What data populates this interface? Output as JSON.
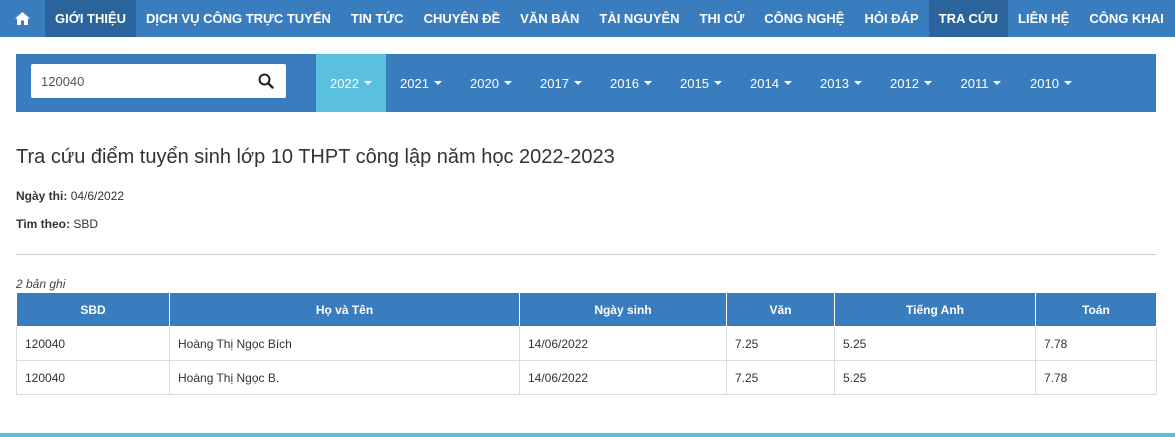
{
  "nav": {
    "home_icon": "home-icon",
    "items": [
      "GIỚI THIỆU",
      "DỊCH VỤ CÔNG TRỰC TUYẾN",
      "TIN TỨC",
      "CHUYÊN ĐỀ",
      "VĂN BẢN",
      "TÀI NGUYÊN",
      "THI CỬ",
      "CÔNG NGHỆ",
      "HỎI ĐÁP",
      "TRA CỨU",
      "LIÊN HỆ",
      "CÔNG KHAI"
    ]
  },
  "search": {
    "value": "120040",
    "icon": "search-icon"
  },
  "years": [
    "2022",
    "2021",
    "2020",
    "2017",
    "2016",
    "2015",
    "2014",
    "2013",
    "2012",
    "2011",
    "2010"
  ],
  "page": {
    "title": "Tra cứu điểm tuyển sinh lớp 10 THPT công lập năm học 2022-2023",
    "exam_date_label": "Ngày thi:",
    "exam_date": "04/6/2022",
    "search_by_label": "Tìm theo:",
    "search_by": "SBD",
    "record_count": "2 bản ghi"
  },
  "table": {
    "headers": [
      "SBD",
      "Họ và Tên",
      "Ngày sinh",
      "Văn",
      "Tiếng Anh",
      "Toán"
    ],
    "rows": [
      [
        "120040",
        "Hoàng Thị Ngọc Bích",
        "14/06/2022",
        "7.25",
        "5.25",
        "7.78"
      ],
      [
        "120040",
        "Hoàng Thị Ngọc B.",
        "14/06/2022",
        "7.25",
        "5.25",
        "7.78"
      ]
    ]
  },
  "colors": {
    "primary": "#3a7dbf",
    "active": "#5bc0de",
    "nav_dark": "#2b649c"
  }
}
